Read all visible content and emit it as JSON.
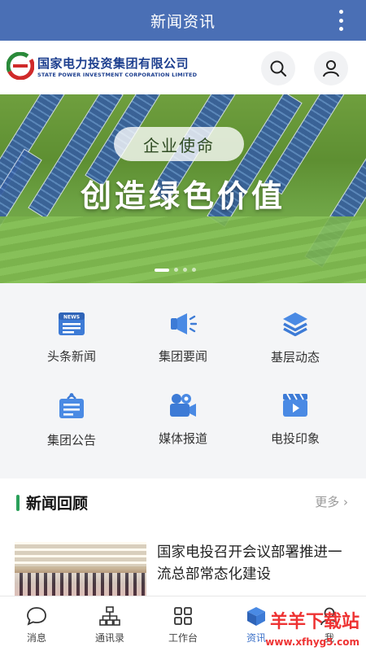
{
  "app": {
    "title": "新闻资讯"
  },
  "brand": {
    "name_cn": "国家电力投资集团有限公司",
    "name_en": "STATE POWER INVESTMENT CORPORATION LIMITED",
    "color": "#1d3f8f"
  },
  "banner": {
    "pill": "企业使命",
    "slogan": "创造绿色价值",
    "slide_count": 4,
    "active_slide": 1
  },
  "menu": [
    {
      "label": "头条新闻",
      "icon": "news-icon"
    },
    {
      "label": "集团要闻",
      "icon": "megaphone-icon"
    },
    {
      "label": "基层动态",
      "icon": "layers-icon"
    },
    {
      "label": "集团公告",
      "icon": "notice-board-icon"
    },
    {
      "label": "媒体报道",
      "icon": "video-camera-icon"
    },
    {
      "label": "电投印象",
      "icon": "film-icon"
    }
  ],
  "review": {
    "title": "新闻回顾",
    "more": "更多",
    "items": [
      {
        "title": "国家电投召开会议部署推进一流总部常态化建设"
      }
    ]
  },
  "tabs": [
    {
      "label": "消息",
      "icon": "chat-bubble-icon"
    },
    {
      "label": "通讯录",
      "icon": "org-chart-icon"
    },
    {
      "label": "工作台",
      "icon": "grid-icon"
    },
    {
      "label": "资讯",
      "icon": "news-cube-icon",
      "active": true
    },
    {
      "label": "我",
      "icon": "user-icon"
    }
  ],
  "colors": {
    "title_bar": "#4a6fb5",
    "accent": "#3f73c9",
    "section_bar": "#2aa05a"
  },
  "watermark": {
    "site": "羊羊下载站",
    "url": "www.xfhyg5.com"
  }
}
